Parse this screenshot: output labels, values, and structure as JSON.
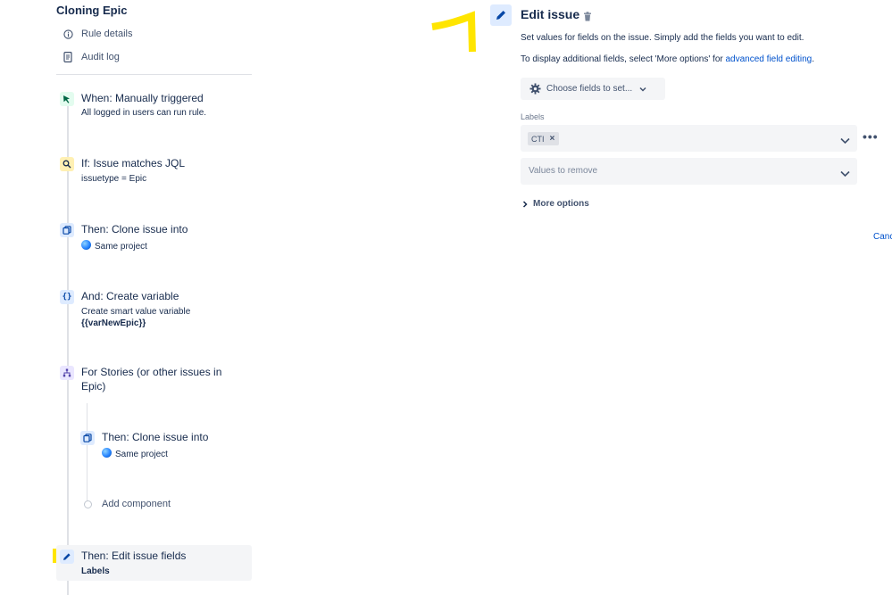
{
  "rule": {
    "title": "Cloning Epic",
    "nav": [
      {
        "label": "Rule details",
        "icon": "info-icon"
      },
      {
        "label": "Audit log",
        "icon": "document-icon"
      }
    ]
  },
  "steps": {
    "trigger": {
      "title": "When: Manually triggered",
      "sub": "All logged in users can run rule.",
      "icon": "cursor-icon"
    },
    "condition": {
      "title": "If: Issue matches JQL",
      "sub": "issuetype = Epic",
      "icon": "search-icon"
    },
    "clone1": {
      "title": "Then: Clone issue into",
      "sub": "Same project",
      "icon": "clone-icon"
    },
    "variable": {
      "title": "And: Create variable",
      "sub": "Create smart value variable",
      "sub2": "{{varNewEpic}}",
      "icon": "braces-icon"
    },
    "branch": {
      "title_line1": "For Stories (or other issues in",
      "title_line2": "Epic)",
      "icon": "branch-icon"
    },
    "clone2": {
      "title": "Then: Clone issue into",
      "sub": "Same project",
      "icon": "clone-icon"
    },
    "add_component": "Add component",
    "edit": {
      "title": "Then: Edit issue fields",
      "sub": "Labels",
      "icon": "pencil-icon"
    }
  },
  "editor": {
    "title": "Edit issue",
    "desc1": "Set values for fields on the issue. Simply add the fields you want to edit.",
    "desc2_prefix": "To display additional fields, select 'More options' for ",
    "desc2_link": "advanced field editing",
    "desc2_suffix": ".",
    "choose_fields": "Choose fields to set...",
    "labels_label": "Labels",
    "label_tag": "CTI",
    "values_to_remove_placeholder": "Values to remove",
    "more_options": "More options",
    "more_dots": "•••",
    "cancel": "Cancel"
  },
  "colors": {
    "accent": "#0052cc",
    "highlight": "#ffe500",
    "trigger_badge": "#e3fcef",
    "condition_badge": "#fff0b3",
    "action_badge": "#deebff",
    "branch_badge": "#eae6ff"
  }
}
